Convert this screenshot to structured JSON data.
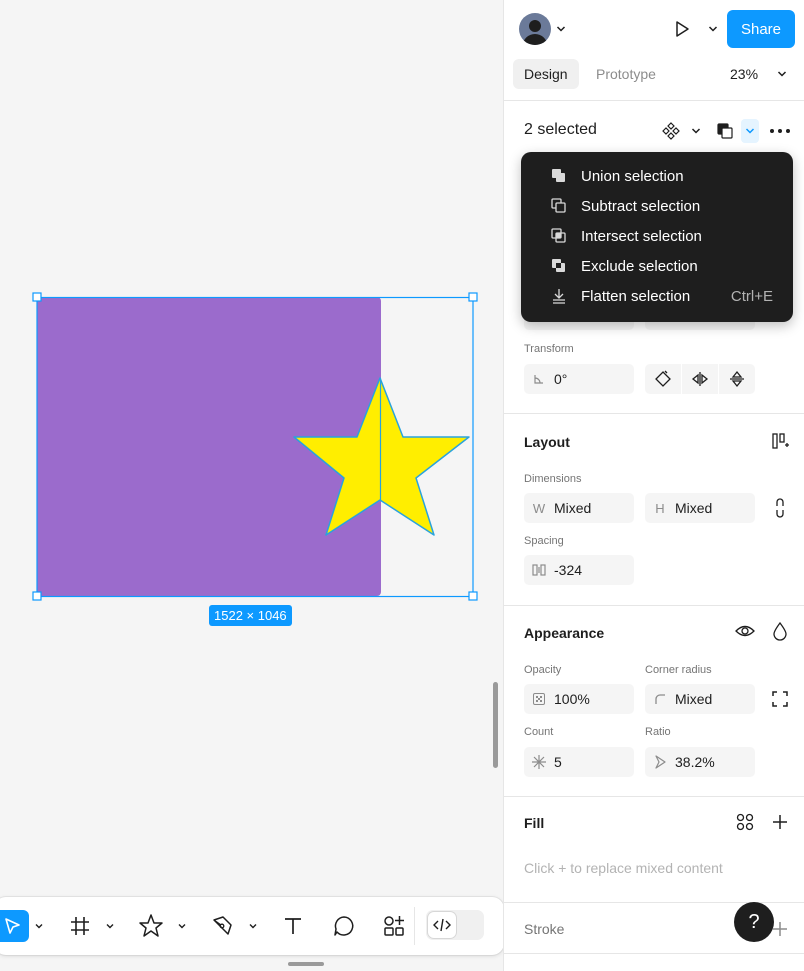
{
  "canvas": {
    "size_badge": "1522 × 1046",
    "colors": {
      "rect": "#9b6bcc",
      "star": "#ffee00",
      "selection": "#0d99ff"
    }
  },
  "toolbar": {
    "tools": [
      "move-tool",
      "frame-tool",
      "shape-tool",
      "pen-tool",
      "text-tool",
      "comment-tool",
      "actions-tool",
      "dev-mode-toggle"
    ]
  },
  "header": {
    "share_label": "Share",
    "tabs": [
      "Design",
      "Prototype"
    ],
    "zoom": "23%"
  },
  "selection": {
    "title": "2 selected"
  },
  "boolean_menu": {
    "items": [
      {
        "label": "Union selection",
        "shortcut": ""
      },
      {
        "label": "Subtract selection",
        "shortcut": ""
      },
      {
        "label": "Intersect selection",
        "shortcut": ""
      },
      {
        "label": "Exclude selection",
        "shortcut": ""
      },
      {
        "label": "Flatten selection",
        "shortcut": "Ctrl+E"
      }
    ]
  },
  "transform": {
    "label": "Transform",
    "rotation": "0°"
  },
  "layout": {
    "title": "Layout",
    "dimensions_label": "Dimensions",
    "w_prefix": "W",
    "w_value": "Mixed",
    "h_prefix": "H",
    "h_value": "Mixed",
    "spacing_label": "Spacing",
    "spacing_value": "-324"
  },
  "appearance": {
    "title": "Appearance",
    "opacity_label": "Opacity",
    "opacity_value": "100%",
    "radius_label": "Corner radius",
    "radius_value": "Mixed",
    "count_label": "Count",
    "count_value": "5",
    "ratio_label": "Ratio",
    "ratio_value": "38.2%"
  },
  "fill": {
    "title": "Fill",
    "placeholder": "Click + to replace mixed content"
  },
  "stroke": {
    "title": "Stroke"
  },
  "help": {
    "label": "?"
  }
}
